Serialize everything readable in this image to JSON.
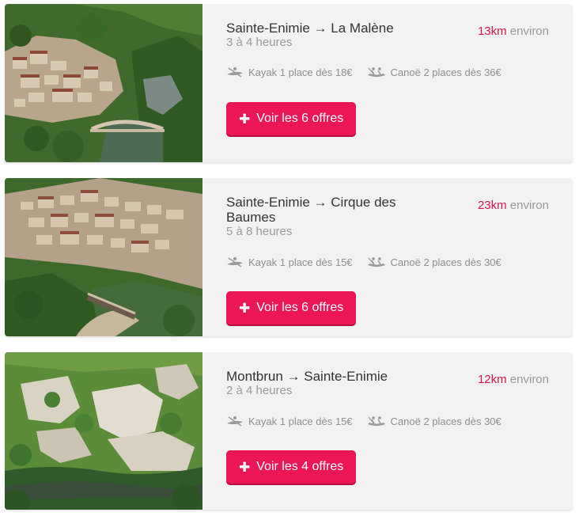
{
  "colors": {
    "accent": "#ec1656",
    "distance": "#e2144d",
    "card_bg": "#f2f2f2"
  },
  "trips": [
    {
      "route": "Sainte-Enimie → La Malène",
      "duration": "3 à 4 heures",
      "distance_value": "13km",
      "distance_suffix": "environ",
      "kayak": "Kayak 1 place dès 18€",
      "canoe": "Canoë 2 places dès 36€",
      "cta": "Voir les 6 offres",
      "photo": "village-bridge-gorge"
    },
    {
      "route": "Sainte-Enimie → Cirque des Baumes",
      "duration": "5 à 8 heures",
      "distance_value": "23km",
      "distance_suffix": "environ",
      "kayak": "Kayak 1 place dès 15€",
      "canoe": "Canoë 2 places dès 30€",
      "cta": "Voir les 6 offres",
      "photo": "village-aerial-river"
    },
    {
      "route": "Montbrun → Sainte-Enimie",
      "duration": "2 à 4 heures",
      "distance_value": "12km",
      "distance_suffix": "environ",
      "kayak": "Kayak 1 place dès 15€",
      "canoe": "Canoë 2 places dès 30€",
      "cta": "Voir les 4 offres",
      "photo": "cliffs-forest-river"
    }
  ],
  "icons": {
    "kayak": "kayak-icon",
    "canoe": "canoe-icon",
    "plus": "plus-icon"
  }
}
